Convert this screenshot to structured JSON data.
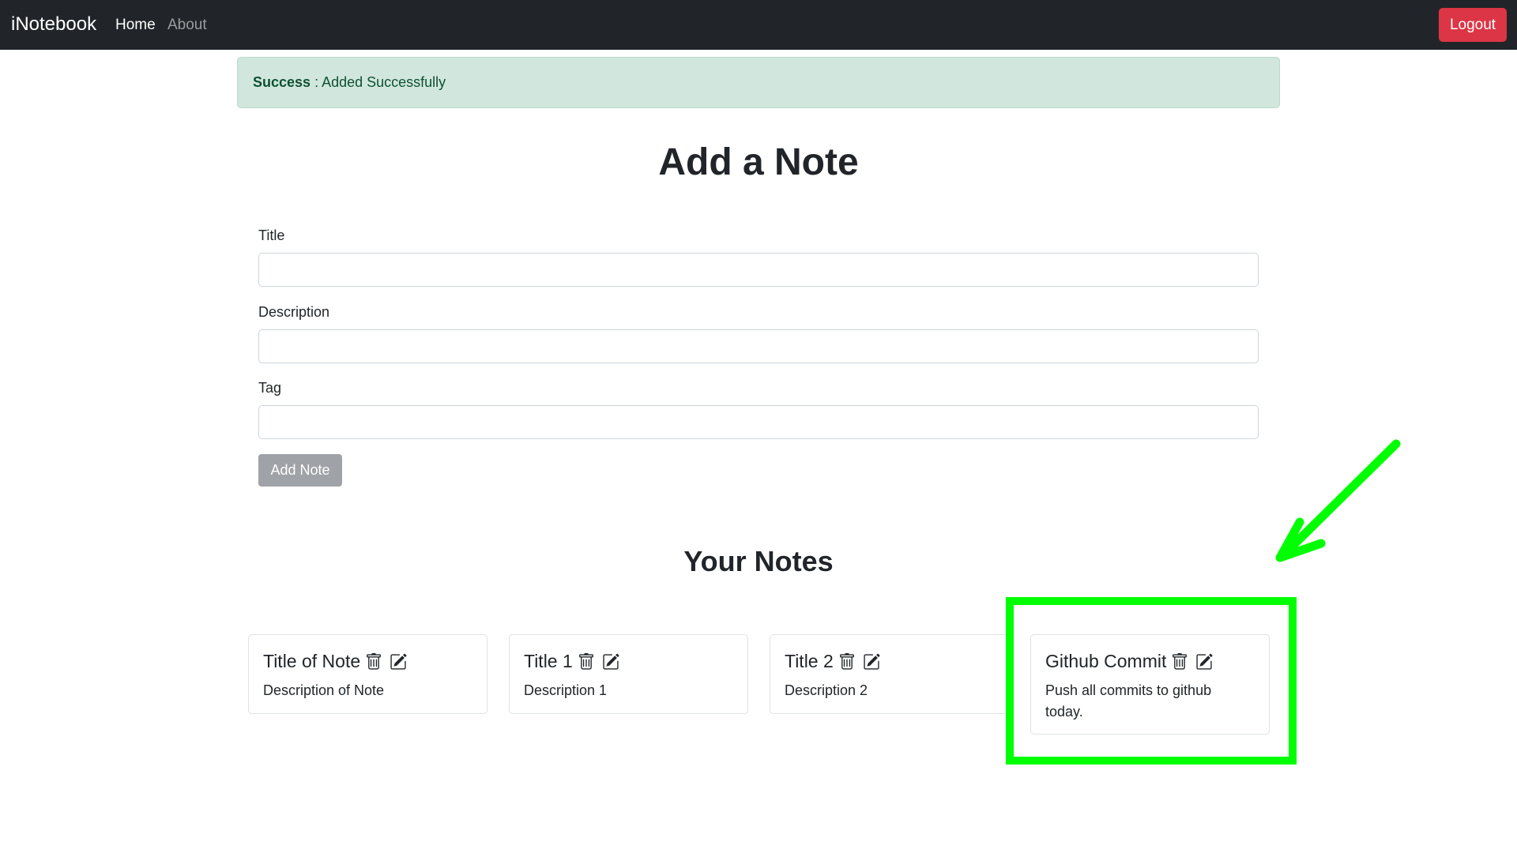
{
  "navbar": {
    "brand": "iNotebook",
    "links": [
      {
        "label": "Home"
      },
      {
        "label": "About"
      }
    ],
    "logout_label": "Logout"
  },
  "alert": {
    "type_label": "Success",
    "separator": " : ",
    "message": "Added Successfully"
  },
  "add_note": {
    "heading": "Add a Note",
    "fields": [
      {
        "label": "Title",
        "value": ""
      },
      {
        "label": "Description",
        "value": ""
      },
      {
        "label": "Tag",
        "value": ""
      }
    ],
    "submit_label": "Add Note"
  },
  "notes_section": {
    "heading": "Your Notes",
    "notes": [
      {
        "title": "Title of Note",
        "description": "Description of Note"
      },
      {
        "title": "Title 1",
        "description": "Description 1"
      },
      {
        "title": "Title 2",
        "description": "Description 2"
      },
      {
        "title": "Github Commit",
        "description": "Push all commits to github today."
      }
    ]
  },
  "icons": {
    "delete": "trash-icon",
    "edit": "edit-icon"
  },
  "colors": {
    "navbar_bg": "#212529",
    "logout_bg": "#dc3545",
    "alert_bg": "#d1e7dd",
    "alert_text": "#0f5132",
    "add_button_bg": "#9fa2a6",
    "annotation": "#00ff00"
  }
}
